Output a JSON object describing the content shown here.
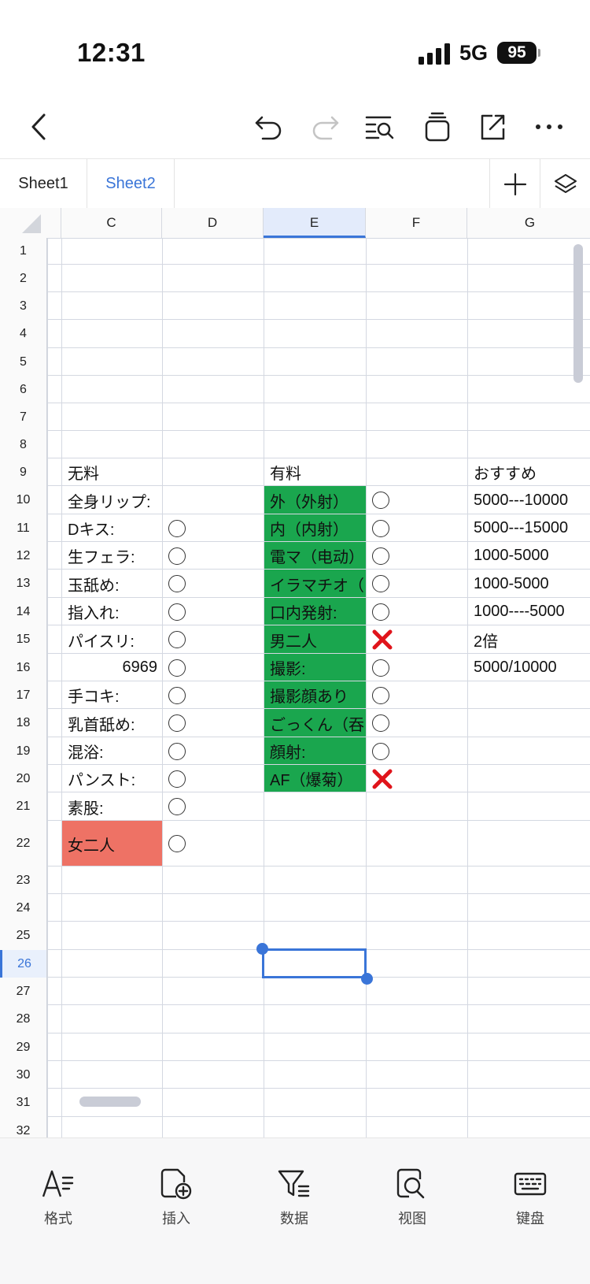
{
  "status_bar": {
    "time": "12:31",
    "network": "5G",
    "battery": "95"
  },
  "toolbar": {
    "icons": [
      "back-icon",
      "undo-icon",
      "redo-icon",
      "find-icon",
      "clear-icon",
      "share-icon",
      "more-icon"
    ]
  },
  "tabs": {
    "items": [
      "Sheet1",
      "Sheet2"
    ],
    "active": "Sheet2"
  },
  "columns": [
    "C",
    "D",
    "E",
    "F",
    "G"
  ],
  "selected_column": "E",
  "rows": [
    "1",
    "2",
    "3",
    "4",
    "5",
    "6",
    "7",
    "8",
    "9",
    "10",
    "11",
    "12",
    "13",
    "14",
    "15",
    "16",
    "17",
    "18",
    "19",
    "20",
    "21",
    "22",
    "23",
    "24",
    "25",
    "26",
    "27",
    "28",
    "29",
    "30",
    "31",
    "32"
  ],
  "selected_row": "26",
  "cells": {
    "c9": "无料",
    "e9": "有料",
    "g9": "おすすめ",
    "c10": "全身リップ:",
    "c11": "Dキス:",
    "c12": "生フェラ:",
    "c13": "玉舐め:",
    "c14": "指入れ:",
    "c15": "パイスリ:",
    "c16": "6969",
    "c17": "手コキ:",
    "c18": "乳首舐め:",
    "c19": "混浴:",
    "c20": "パンスト:",
    "c21": "素股:",
    "c22": "女二人",
    "e10": "外（外射）",
    "e11": "内（内射）",
    "e12": "電マ（电动）",
    "e13": "イラマチオ（",
    "e14": "口内発射:",
    "e15": "男二人",
    "e16": "撮影:",
    "e17": "撮影顔あり",
    "e18": "ごっくん（吞",
    "e19": "顔射:",
    "e20": "AF（爆菊）",
    "g10": "5000---10000",
    "g11": "5000---15000",
    "g12": "1000-5000",
    "g13": "1000-5000",
    "g14": "1000----5000",
    "g15": "2倍",
    "g16": "5000/10000"
  },
  "marks": {
    "D": [
      "11",
      "12",
      "13",
      "14",
      "15",
      "16",
      "17",
      "18",
      "19",
      "20",
      "21",
      "22"
    ],
    "F_circle": [
      "10",
      "11",
      "12",
      "13",
      "14",
      "16",
      "17",
      "18",
      "19"
    ],
    "F_cross": [
      "15",
      "20"
    ]
  },
  "fills": {
    "green_range": "E10:E20",
    "red_cell": "C22",
    "green": "#1aa64e",
    "red": "#ee7265",
    "accent": "#3a75d8"
  },
  "bottom_bar": {
    "format": "格式",
    "insert": "插入",
    "data": "数据",
    "view": "视图",
    "keyboard": "键盘"
  }
}
